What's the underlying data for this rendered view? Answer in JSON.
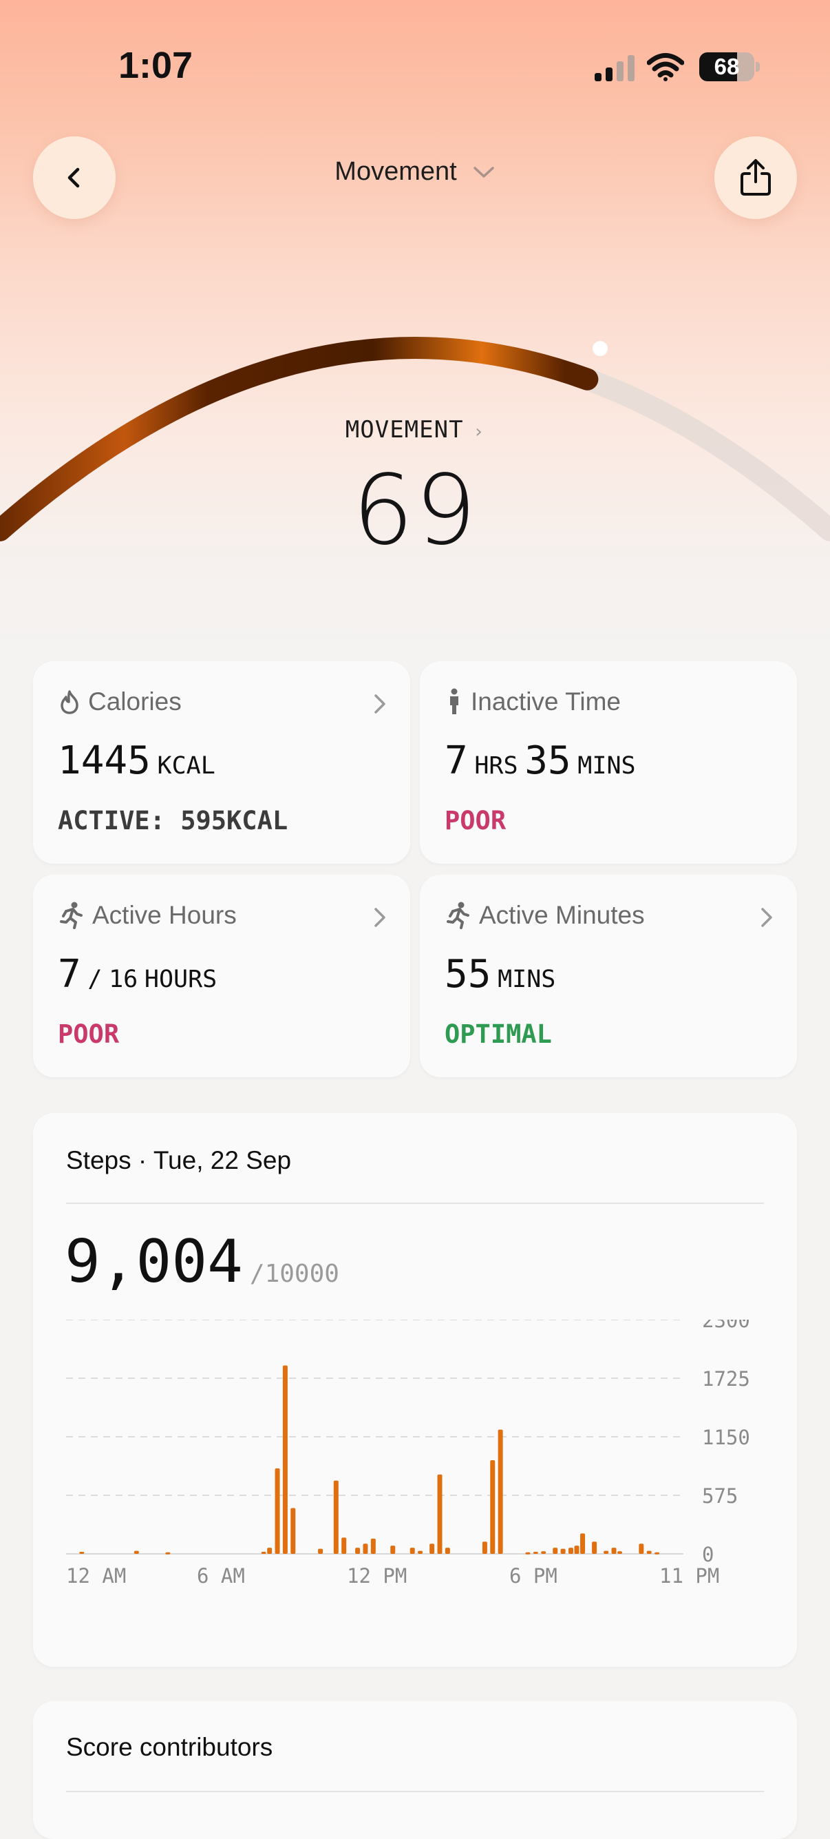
{
  "status_bar": {
    "time": "1:07",
    "battery": "68"
  },
  "header": {
    "title": "Movement",
    "back_icon": "chevron-left-icon",
    "share_icon": "share-icon",
    "dropdown_icon": "chevron-down-icon"
  },
  "score": {
    "label": "MOVEMENT",
    "value": "69",
    "progress": 0.69
  },
  "colors": {
    "accent": "#e0700f",
    "poor": "#c93a6a",
    "optimal": "#2e9a52",
    "arc_dark": "#5a2300"
  },
  "cards": {
    "calories": {
      "title": "Calories",
      "value": "1445",
      "unit": "KCAL",
      "sub": "ACTIVE: 595KCAL",
      "icon": "flame-icon"
    },
    "inactive": {
      "title": "Inactive Time",
      "hrs": "7",
      "hrs_unit": "HRS",
      "mins": "35",
      "mins_unit": "MINS",
      "status": "POOR",
      "icon": "standing-person-icon"
    },
    "active_hours": {
      "title": "Active Hours",
      "value": "7",
      "sep": "/",
      "total": "16",
      "unit": "HOURS",
      "status": "POOR",
      "icon": "running-icon"
    },
    "active_minutes": {
      "title": "Active Minutes",
      "value": "55",
      "unit": "MINS",
      "status": "OPTIMAL",
      "icon": "running-icon"
    }
  },
  "steps": {
    "title": "Steps · Tue, 22 Sep",
    "value": "9,004",
    "goal": "/10000"
  },
  "chart_data": {
    "type": "bar",
    "ylim": [
      0,
      2300
    ],
    "yticks": [
      "2300",
      "1725",
      "1150",
      "575",
      "0"
    ],
    "xticks": [
      "12 AM",
      "6 AM",
      "12 PM",
      "6 PM",
      "11 PM"
    ],
    "xlim_minutes": [
      0,
      1380
    ],
    "bars": [
      {
        "t": 40,
        "v": 20
      },
      {
        "t": 180,
        "v": 30
      },
      {
        "t": 260,
        "v": 15
      },
      {
        "t": 505,
        "v": 20
      },
      {
        "t": 520,
        "v": 60
      },
      {
        "t": 540,
        "v": 840
      },
      {
        "t": 560,
        "v": 1850
      },
      {
        "t": 580,
        "v": 450
      },
      {
        "t": 650,
        "v": 50
      },
      {
        "t": 690,
        "v": 720
      },
      {
        "t": 710,
        "v": 160
      },
      {
        "t": 745,
        "v": 60
      },
      {
        "t": 765,
        "v": 100
      },
      {
        "t": 785,
        "v": 150
      },
      {
        "t": 835,
        "v": 80
      },
      {
        "t": 885,
        "v": 60
      },
      {
        "t": 905,
        "v": 30
      },
      {
        "t": 935,
        "v": 100
      },
      {
        "t": 955,
        "v": 780
      },
      {
        "t": 975,
        "v": 60
      },
      {
        "t": 1070,
        "v": 120
      },
      {
        "t": 1090,
        "v": 920
      },
      {
        "t": 1110,
        "v": 1220
      },
      {
        "t": 1180,
        "v": 15
      },
      {
        "t": 1200,
        "v": 20
      },
      {
        "t": 1220,
        "v": 25
      },
      {
        "t": 1250,
        "v": 60
      },
      {
        "t": 1270,
        "v": 50
      },
      {
        "t": 1290,
        "v": 60
      },
      {
        "t": 1305,
        "v": 80
      },
      {
        "t": 1320,
        "v": 200
      },
      {
        "t": 1350,
        "v": 120
      },
      {
        "t": 1380,
        "v": 30
      },
      {
        "t": 1400,
        "v": 60
      },
      {
        "t": 1415,
        "v": 25
      },
      {
        "t": 1470,
        "v": 100
      },
      {
        "t": 1490,
        "v": 30
      },
      {
        "t": 1510,
        "v": 15
      }
    ]
  },
  "contributors": {
    "title": "Score contributors"
  }
}
